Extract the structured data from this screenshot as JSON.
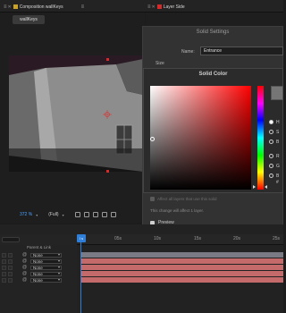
{
  "tabs": {
    "composition": {
      "label": "Composition wallKeys",
      "color": "#c9a227"
    },
    "layer": {
      "label": "Layer Side",
      "color": "#d62a2a"
    }
  },
  "comp": {
    "tag": "wallKeys",
    "zoom": "372 %",
    "resolution": "(Full)"
  },
  "solid_settings": {
    "title": "Solid Settings",
    "name_label": "Name:",
    "name_value": "Entrance",
    "size_label": "Size",
    "affect_all_label": "Affect all layers that use this solid",
    "affect_note": "This change will affect 1 layer.",
    "preview_label": "Preview"
  },
  "solid_color": {
    "title": "Solid Color",
    "radios": [
      {
        "label": "H",
        "on": true
      },
      {
        "label": "S",
        "on": false
      },
      {
        "label": "B",
        "on": false
      },
      {
        "label": "R",
        "on": false
      },
      {
        "label": "G",
        "on": false
      },
      {
        "label": "B",
        "on": false
      }
    ],
    "hex_prefix": "#",
    "swatch_color": "#767676"
  },
  "timeline": {
    "current_time": "0s",
    "ticks": [
      "05s",
      "10s",
      "15s",
      "20s",
      "25s"
    ],
    "headers": {
      "parent": "Parent & Link"
    },
    "layers": [
      {
        "parent": "None",
        "color": "#7a7a85"
      },
      {
        "parent": "None",
        "color": "#c46a6a"
      },
      {
        "parent": "None",
        "color": "#c46a6a"
      },
      {
        "parent": "None",
        "color": "#c46a6a"
      },
      {
        "parent": "None",
        "color": "#c46a6a"
      }
    ]
  }
}
